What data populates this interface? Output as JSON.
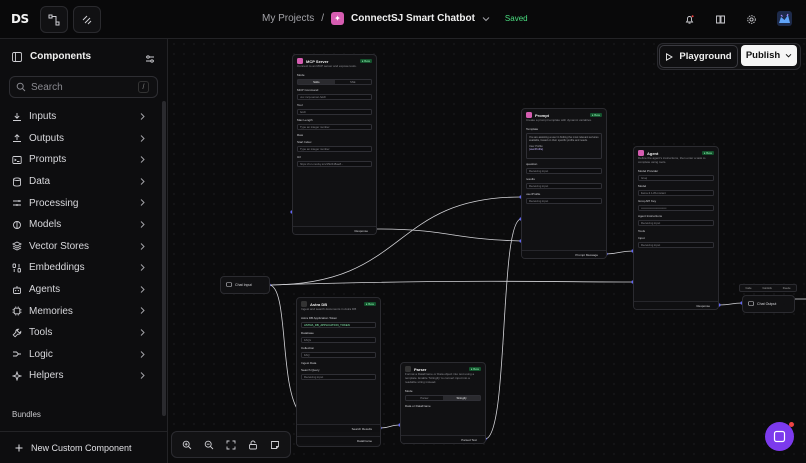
{
  "topbar": {
    "logo": "DS",
    "breadcrumb_root": "My Projects",
    "breadcrumb_sep": "/",
    "project_name": "ConnectSJ Smart Chatbot",
    "status": "Saved"
  },
  "sidebar": {
    "title": "Components",
    "search_placeholder": "Search",
    "search_shortcut": "/",
    "categories": [
      {
        "label": "Inputs",
        "icon": "download-icon"
      },
      {
        "label": "Outputs",
        "icon": "upload-icon"
      },
      {
        "label": "Prompts",
        "icon": "terminal-icon"
      },
      {
        "label": "Data",
        "icon": "database-icon"
      },
      {
        "label": "Processing",
        "icon": "processing-icon"
      },
      {
        "label": "Models",
        "icon": "brain-icon"
      },
      {
        "label": "Vector Stores",
        "icon": "layers-icon"
      },
      {
        "label": "Embeddings",
        "icon": "binary-icon"
      },
      {
        "label": "Agents",
        "icon": "bot-icon"
      },
      {
        "label": "Memories",
        "icon": "cpu-icon"
      },
      {
        "label": "Tools",
        "icon": "wrench-icon"
      },
      {
        "label": "Logic",
        "icon": "logic-icon"
      },
      {
        "label": "Helpers",
        "icon": "sparkle-icon"
      }
    ],
    "bundles_label": "Bundles",
    "footer_label": "New Custom Component"
  },
  "toolbar": {
    "playground_label": "Playground",
    "publish_label": "Publish"
  },
  "nodes": {
    "mcp": {
      "title": "MCP Server",
      "badge": "● Beta",
      "desc": "Connect to an MCP server and expose tools.",
      "mode_label": "Mode",
      "mode_options": [
        "Stdio",
        "SSE"
      ],
      "command_label": "MCP Command",
      "command_value": "uvx mcp-server-fetch",
      "tool_label": "Tool",
      "tool_value": "fetch",
      "max_length_label": "Max Length",
      "max_length_placeholder": "Type an integer number",
      "raw_label": "Raw",
      "start_index_label": "Start Index",
      "start_index_placeholder": "Type an integer number",
      "url_label": "Url",
      "url_value": "https://run.mocky.io/v3/92448ae8...",
      "output": "Response"
    },
    "prompt": {
      "title": "Prompt",
      "badge": "● Beta",
      "desc": "Create a prompt template with dynamic variables.",
      "template_label": "Template",
      "template_text": "You are assisting a user in finding the most relevant services available, based on their specific profile and needs.",
      "template_text2": "User Profile:",
      "template_var": "{userProfile}",
      "question_label": "question",
      "results_label": "results",
      "userprofile_label": "userProfile",
      "receiving": "Receiving input",
      "output": "Prompt Message"
    },
    "agent": {
      "title": "Agent",
      "badge": "● Beta",
      "desc": "Define the agent's instructions, then enter a task to complete using tools.",
      "provider_label": "Model Provider",
      "provider_value": "Groq",
      "model_label": "Model",
      "model_value": "llama-3.1-8b-instant",
      "api_label": "Groq API Key",
      "api_value": "••••••••••••••••••••••••••",
      "instructions_label": "Agent Instructions",
      "tools_label": "Tools",
      "input_label": "Input",
      "receiving": "Receiving input",
      "output": "Response"
    },
    "chat_input": {
      "title": "Chat Input"
    },
    "chat_output": {
      "title": "Chat Output"
    },
    "astra": {
      "title": "Astra DB",
      "badge": "● Beta",
      "desc": "Ingest and search documents in Astra DB",
      "token_label": "Astra DB Application Token",
      "token_value": "ASTRA_DB_APPLICATION_TOKEN",
      "database_label": "Database",
      "database_value": "FAQs",
      "collection_label": "Collection",
      "collection_value": "FAQ",
      "ingest_label": "Ingest Data",
      "search_label": "Search Query",
      "receiving": "Receiving input",
      "output1": "Search Results",
      "output2": "DataFrame"
    },
    "parser": {
      "title": "Parser",
      "badge": "● Beta",
      "desc": "Format a DataFrame or Data object into text using a template. Enable 'Stringify' to convert input into a readable string instead.",
      "mode_label": "Mode",
      "mode_options": [
        "Parser",
        "Stringify"
      ],
      "data_label": "Data or DataFrame",
      "output": "Parsed Text"
    }
  },
  "mini_toolbar": [
    "Code",
    "Controls",
    "Freeze"
  ],
  "colors": {
    "accent": "#7c3aed",
    "brand_pink": "#d65db1",
    "status_green": "#4ade80",
    "edge": "#d4d4d8",
    "edge_port": "#6366f1"
  }
}
